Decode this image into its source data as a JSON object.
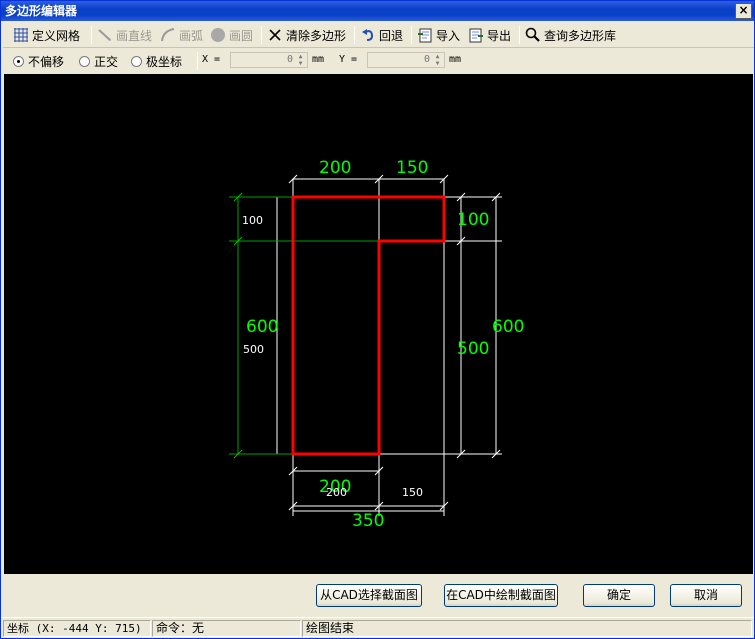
{
  "window": {
    "title": "多边形编辑器",
    "close_glyph": "×"
  },
  "toolbar": {
    "items": [
      {
        "label": "定义网格",
        "icon": "grid-icon",
        "enabled": true
      },
      {
        "label": "画直线",
        "icon": "line-icon",
        "enabled": false
      },
      {
        "label": "画弧",
        "icon": "arc-icon",
        "enabled": false
      },
      {
        "label": "画圆",
        "icon": "circle-icon",
        "enabled": false
      },
      {
        "label": "清除多边形",
        "icon": "clear-icon",
        "enabled": true
      },
      {
        "label": "回退",
        "icon": "undo-icon",
        "enabled": true
      },
      {
        "label": "导入",
        "icon": "import-icon",
        "enabled": true
      },
      {
        "label": "导出",
        "icon": "export-icon",
        "enabled": true
      },
      {
        "label": "查询多边形库",
        "icon": "search-icon",
        "enabled": true
      }
    ]
  },
  "snap": {
    "options": [
      {
        "label": "不偏移",
        "selected": true
      },
      {
        "label": "正交",
        "selected": false
      },
      {
        "label": "极坐标",
        "selected": false
      }
    ],
    "x_label": "X =",
    "x_value": "0",
    "x_unit": "mm",
    "y_label": "Y =",
    "y_value": "0",
    "y_unit": "mm"
  },
  "drawing": {
    "dims": {
      "top_left": "200",
      "top_right": "150",
      "right_small": "100",
      "right_large": "600",
      "right_mid": "500",
      "left_small": "100",
      "left_large": "600",
      "left_mid": "500",
      "bottom_stem": "200",
      "bottom_stem_white": "200",
      "bottom_right_white": "150",
      "bottom_total": "350"
    },
    "colors": {
      "outline": "#ff0000",
      "dim_green": "#00ff00",
      "dim_white": "#ffffff",
      "dim_line_green": "#00a000"
    }
  },
  "actions": {
    "cad_select": "从CAD选择截面图",
    "cad_draw": "在CAD中绘制截面图",
    "ok": "确定",
    "cancel": "取消"
  },
  "statusbar": {
    "coords": "坐标 (X: -444 Y: 715)",
    "command": "命令：无",
    "message": "绘图结束"
  }
}
